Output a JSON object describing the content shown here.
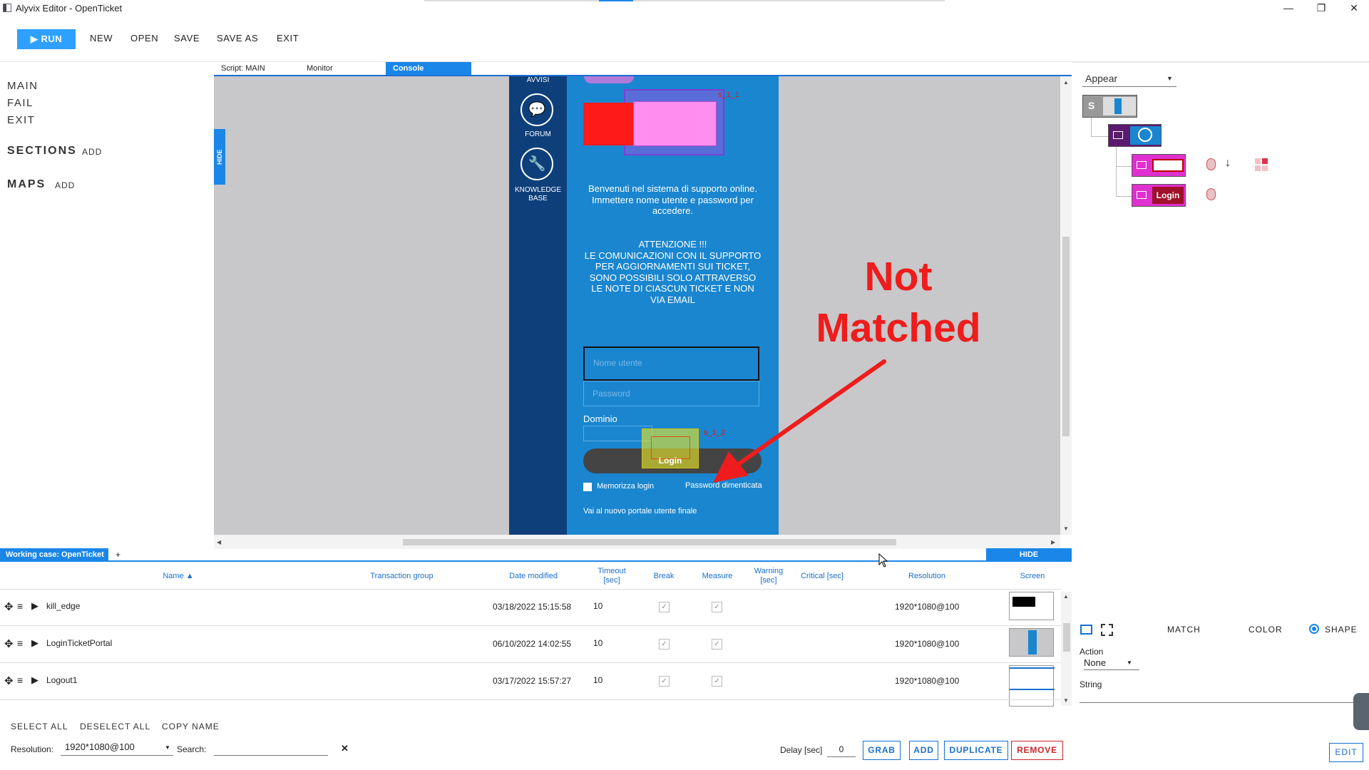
{
  "window": {
    "title": "Alyvix Editor - OpenTicket"
  },
  "toolbar": {
    "run": "RUN",
    "new": "NEW",
    "open": "OPEN",
    "save": "SAVE",
    "save_as": "SAVE AS",
    "exit": "EXIT",
    "accent": "#2ea0ff"
  },
  "left": {
    "items": [
      "MAIN",
      "FAIL",
      "EXIT"
    ],
    "sections": "SECTIONS",
    "maps": "MAPS",
    "add": "ADD"
  },
  "editor_tabs": [
    "Script: MAIN",
    "Monitor",
    "Console"
  ],
  "hide_label": "HIDE",
  "portal": {
    "sidebar_top": "AVVISI",
    "forum": "FORUM",
    "kb": "KNOWLEDGE BASE",
    "welcome": [
      "Benvenuti nel sistema di supporto online.",
      "Immettere nome utente e password per",
      "accedere."
    ],
    "warning": [
      "ATTENZIONE !!!",
      "LE COMUNICAZIONI CON IL SUPPORTO",
      "PER AGGIORNAMENTI SUI TICKET,",
      "SONO POSSIBILI SOLO ATTRAVERSO",
      "LE NOTE DI CIASCUN TICKET E NON",
      "VIA EMAIL"
    ],
    "user_placeholder": "Nome utente",
    "pass_placeholder": "Password",
    "domain_label": "Dominio",
    "login_button": "Login",
    "remember": "Memorizza login",
    "forgot": "Password dimenticata",
    "new_portal": "Vai al nuovo portale utente finale",
    "box_tag_1": "s_1_1",
    "box_tag_2": "s_1_2"
  },
  "annotation": {
    "line1": "Not",
    "line2": "Matched",
    "color": "#ee1c1c"
  },
  "tree": {
    "mode": "Appear",
    "root_label": "S",
    "login_label": "Login"
  },
  "right_bottom": {
    "match": "MATCH",
    "color": "COLOR",
    "shape": "SHAPE",
    "action_label": "Action",
    "action_value": "None",
    "string_label": "String",
    "edit": "EDIT"
  },
  "working_case": {
    "tab": "Working case: OpenTicket",
    "add": "+"
  },
  "table": {
    "headers": {
      "name": "Name ▲",
      "transaction_group": "Transaction group",
      "date_modified": "Date modified",
      "timeout": [
        "Timeout",
        "[sec]"
      ],
      "break": "Break",
      "measure": "Measure",
      "warning": [
        "Warning",
        "[sec]"
      ],
      "critical": "Critical [sec]",
      "resolution": "Resolution",
      "screen": "Screen"
    },
    "rows": [
      {
        "name": "kill_edge",
        "date": "03/18/2022 15:15:58",
        "timeout": "10",
        "resolution": "1920*1080@100"
      },
      {
        "name": "LoginTicketPortal",
        "date": "06/10/2022 14:02:55",
        "timeout": "10",
        "resolution": "1920*1080@100"
      },
      {
        "name": "Logout1",
        "date": "03/17/2022 15:57:27",
        "timeout": "10",
        "resolution": "1920*1080@100"
      }
    ]
  },
  "bottom": {
    "select_all": "SELECT ALL",
    "deselect_all": "DESELECT ALL",
    "copy_name": "COPY NAME",
    "resolution_label": "Resolution:",
    "resolution_value": "1920*1080@100",
    "search_label": "Search:",
    "search_value": "",
    "clear": "✕",
    "delay_label": "Delay [sec]",
    "delay_value": "0",
    "grab": "GRAB",
    "add": "ADD",
    "duplicate": "DUPLICATE",
    "remove": "REMOVE"
  }
}
